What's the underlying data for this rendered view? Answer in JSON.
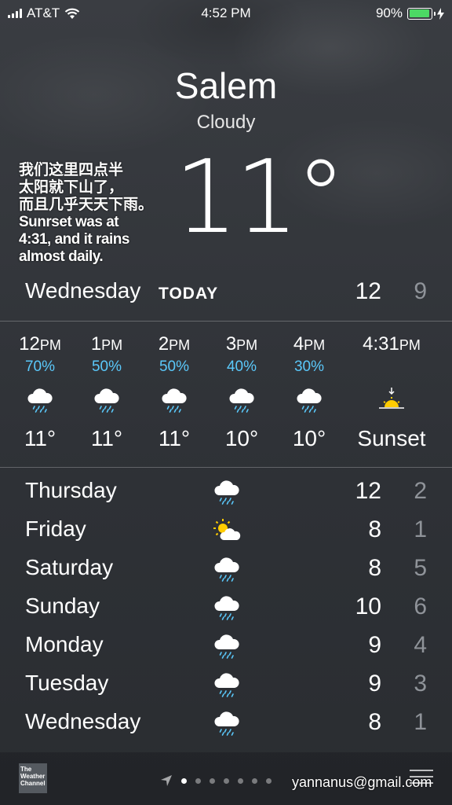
{
  "status_bar": {
    "carrier": "AT&T",
    "time": "4:52 PM",
    "battery": "90%"
  },
  "location": {
    "city": "Salem",
    "condition": "Cloudy",
    "temperature": "11°"
  },
  "overlay_note": {
    "zh_line1": "我们这里四点半",
    "zh_line2": "太阳就下山了，",
    "zh_line3": "而且几乎天天下雨。",
    "en_line1": "Sunrset was at",
    "en_line2": "4:31, and it rains",
    "en_line3": "almost daily."
  },
  "today": {
    "day": "Wednesday",
    "label": "TODAY",
    "high": "12",
    "low": "9"
  },
  "hourly": [
    {
      "hour": "12",
      "ampm": "PM",
      "precip": "70%",
      "icon": "rain-cloud-icon",
      "temp": "11°"
    },
    {
      "hour": "1",
      "ampm": "PM",
      "precip": "50%",
      "icon": "rain-cloud-icon",
      "temp": "11°"
    },
    {
      "hour": "2",
      "ampm": "PM",
      "precip": "50%",
      "icon": "rain-cloud-icon",
      "temp": "11°"
    },
    {
      "hour": "3",
      "ampm": "PM",
      "precip": "40%",
      "icon": "rain-cloud-icon",
      "temp": "10°"
    },
    {
      "hour": "4",
      "ampm": "PM",
      "precip": "30%",
      "icon": "rain-cloud-icon",
      "temp": "10°"
    },
    {
      "hour": "4:31",
      "ampm": "PM",
      "precip": "",
      "icon": "sunset-icon",
      "temp": "Sunset"
    }
  ],
  "daily": [
    {
      "day": "Thursday",
      "icon": "rain-cloud-icon",
      "high": "12",
      "low": "2"
    },
    {
      "day": "Friday",
      "icon": "partly-sunny-icon",
      "high": "8",
      "low": "1"
    },
    {
      "day": "Saturday",
      "icon": "rain-cloud-icon",
      "high": "8",
      "low": "5"
    },
    {
      "day": "Sunday",
      "icon": "rain-cloud-icon",
      "high": "10",
      "low": "6"
    },
    {
      "day": "Monday",
      "icon": "rain-cloud-icon",
      "high": "9",
      "low": "4"
    },
    {
      "day": "Tuesday",
      "icon": "rain-cloud-icon",
      "high": "9",
      "low": "3"
    },
    {
      "day": "Wednesday",
      "icon": "rain-cloud-icon",
      "high": "8",
      "low": "1"
    }
  ],
  "footer": {
    "logo_text": "The Weather Channel",
    "email": "yannanus@gmail.com"
  },
  "colors": {
    "precip": "#5ac8fa",
    "battery": "#4cd964",
    "low_temp": "#8f9399",
    "sun": "#ffcc00"
  }
}
